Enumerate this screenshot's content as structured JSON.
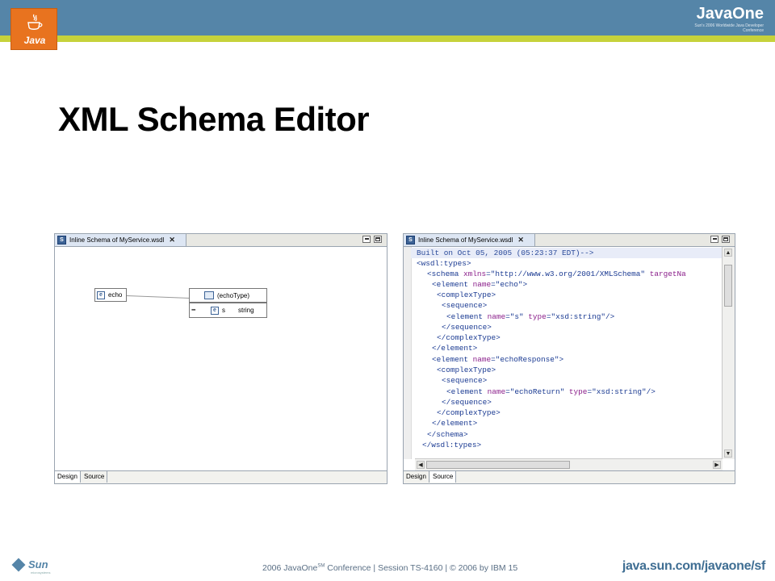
{
  "header": {
    "java_logo_text": "Java",
    "brand_name": "JavaOne",
    "brand_tagline": "Sun's 2006 Worldwide Java Developer Conference",
    "colors": {
      "bar": "#5585a8",
      "stripe": "#c6d23b",
      "logo": "#e8731f"
    }
  },
  "slide": {
    "title": "XML Schema Editor"
  },
  "left_editor": {
    "tab_label": "Inline Schema of MyService.wsdl",
    "icons": [
      "schema-file-icon",
      "close-icon",
      "minimize-icon",
      "maximize-icon"
    ],
    "diagram": {
      "element_node": {
        "icon": "e",
        "label": "echo"
      },
      "type_node": {
        "label": "(echoType)"
      },
      "child_row": {
        "icon": "e",
        "name": "s",
        "type": "string"
      }
    },
    "bottom_tabs": [
      "Design",
      "Source"
    ],
    "active_tab": "Design"
  },
  "right_editor": {
    "tab_label": "Inline Schema of MyService.wsdl",
    "code": {
      "line1": "Built on Oct 05, 2005 (05:23:37 EDT)-->",
      "line2": "<wsdl:types>",
      "line3_tag": "<schema ",
      "line3_attr": "xmlns",
      "line3_val": "=\"http://www.w3.org/2001/XMLSchema\" ",
      "line3_attr2": "targetNa",
      "line4_tag": "<element ",
      "line4_attr": "name",
      "line4_val": "=\"echo\">",
      "line5": "<complexType>",
      "line6": "<sequence>",
      "line7_tag": "<element ",
      "line7_attr": "name",
      "line7_val": "=\"s\" ",
      "line7_attr2": "type",
      "line7_val2": "=\"xsd:string\"/>",
      "line8": "</sequence>",
      "line9": "</complexType>",
      "line10": "</element>",
      "line11_tag": "<element ",
      "line11_attr": "name",
      "line11_val": "=\"echoResponse\">",
      "line12": "<complexType>",
      "line13": "<sequence>",
      "line14_tag": "<element ",
      "line14_attr": "name",
      "line14_val": "=\"echoReturn\" ",
      "line14_attr2": "type",
      "line14_val2": "=\"xsd:string\"/>",
      "line15": "</sequence>",
      "line16": "</complexType>",
      "line17": "</element>",
      "line18": "</schema>",
      "line19": "</wsdl:types>"
    },
    "bottom_tabs": [
      "Design",
      "Source"
    ],
    "active_tab": "Source"
  },
  "footer": {
    "sun_logo_text": "Sun",
    "sun_sub": "microsystems",
    "conference": "2006 JavaOne",
    "sm": "SM",
    "rest": " Conference   |   Session TS-4160   | © 2006 by IBM    15",
    "url": "java.sun.com/javaone/sf"
  }
}
